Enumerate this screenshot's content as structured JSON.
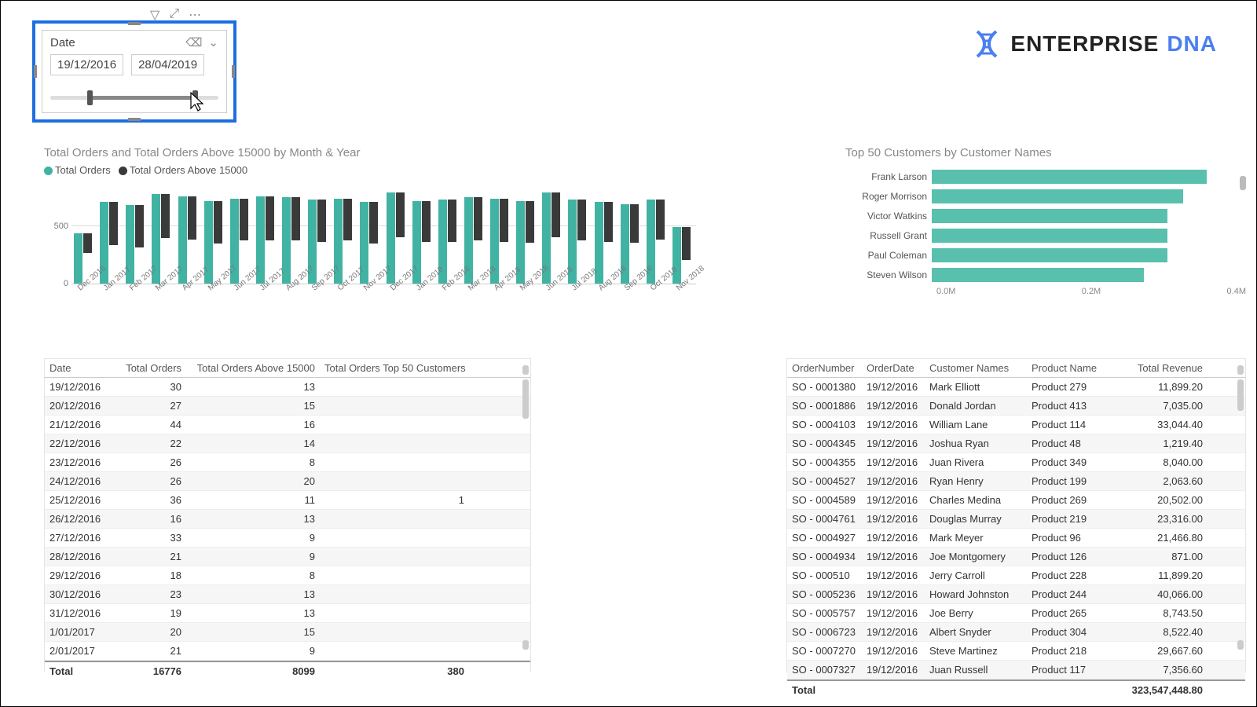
{
  "logo": {
    "text1": "ENTERPRISE",
    "text2": "DNA"
  },
  "slicer": {
    "label": "Date",
    "from": "19/12/2016",
    "to": "28/04/2019"
  },
  "chart_data": [
    {
      "type": "bar",
      "title": "Total Orders and Total Orders Above 15000 by Month & Year",
      "legend": [
        "Total Orders",
        "Total Orders Above 15000"
      ],
      "ylabel": "",
      "ylim": [
        0,
        900
      ],
      "ytick": 500,
      "categories": [
        "Dec 2016",
        "Jan 2017",
        "Feb 2017",
        "Mar 2017",
        "Apr 2017",
        "May 2017",
        "Jun 2017",
        "Jul 2017",
        "Aug 2017",
        "Sep 2017",
        "Oct 2017",
        "Nov 2017",
        "Dec 2017",
        "Jan 2018",
        "Feb 2018",
        "Mar 2018",
        "Apr 2018",
        "May 2018",
        "Jun 2018",
        "Jul 2018",
        "Aug 2018",
        "Sep 2018",
        "Oct 2018",
        "Nov 2018"
      ],
      "series": [
        {
          "name": "Total Orders",
          "color": "#41b3a3",
          "values": [
            440,
            720,
            690,
            790,
            770,
            730,
            750,
            770,
            760,
            740,
            750,
            720,
            800,
            730,
            740,
            760,
            750,
            730,
            800,
            740,
            720,
            700,
            740,
            500
          ]
        },
        {
          "name": "Total Orders Above 15000",
          "color": "#3a3a3a",
          "values": [
            170,
            380,
            370,
            390,
            380,
            380,
            370,
            390,
            380,
            370,
            370,
            370,
            390,
            360,
            370,
            380,
            380,
            370,
            390,
            360,
            350,
            340,
            350,
            290
          ]
        }
      ]
    },
    {
      "type": "bar",
      "orientation": "horizontal",
      "title": "Top 50 Customers by Customer Names",
      "xlabel": "",
      "xlim": [
        0,
        0.4
      ],
      "xticks": [
        "0.0M",
        "0.2M",
        "0.4M"
      ],
      "categories": [
        "Frank Larson",
        "Roger Morrison",
        "Victor Watkins",
        "Russell Grant",
        "Paul Coleman",
        "Steven Wilson"
      ],
      "values": [
        0.35,
        0.32,
        0.3,
        0.3,
        0.3,
        0.27
      ]
    }
  ],
  "table_left": {
    "headers": [
      "Date",
      "Total Orders",
      "Total Orders Above 15000",
      "Total Orders Top 50 Customers"
    ],
    "rows": [
      [
        "19/12/2016",
        "30",
        "13",
        ""
      ],
      [
        "20/12/2016",
        "27",
        "15",
        ""
      ],
      [
        "21/12/2016",
        "44",
        "16",
        ""
      ],
      [
        "22/12/2016",
        "22",
        "14",
        ""
      ],
      [
        "23/12/2016",
        "26",
        "8",
        ""
      ],
      [
        "24/12/2016",
        "26",
        "20",
        ""
      ],
      [
        "25/12/2016",
        "36",
        "11",
        "1"
      ],
      [
        "26/12/2016",
        "16",
        "13",
        ""
      ],
      [
        "27/12/2016",
        "33",
        "9",
        ""
      ],
      [
        "28/12/2016",
        "21",
        "9",
        ""
      ],
      [
        "29/12/2016",
        "18",
        "8",
        ""
      ],
      [
        "30/12/2016",
        "23",
        "13",
        ""
      ],
      [
        "31/12/2016",
        "19",
        "13",
        ""
      ],
      [
        "1/01/2017",
        "20",
        "15",
        ""
      ],
      [
        "2/01/2017",
        "21",
        "9",
        ""
      ]
    ],
    "footer": [
      "Total",
      "16776",
      "8099",
      "380"
    ]
  },
  "table_right": {
    "headers": [
      "OrderNumber",
      "OrderDate",
      "Customer Names",
      "Product Name",
      "Total Revenue"
    ],
    "rows": [
      [
        "SO - 0001380",
        "19/12/2016",
        "Mark Elliott",
        "Product 279",
        "11,899.20"
      ],
      [
        "SO - 0001886",
        "19/12/2016",
        "Donald Jordan",
        "Product 413",
        "7,035.00"
      ],
      [
        "SO - 0004103",
        "19/12/2016",
        "William Lane",
        "Product 114",
        "33,044.40"
      ],
      [
        "SO - 0004345",
        "19/12/2016",
        "Joshua Ryan",
        "Product 48",
        "1,219.40"
      ],
      [
        "SO - 0004355",
        "19/12/2016",
        "Juan Rivera",
        "Product 349",
        "8,040.00"
      ],
      [
        "SO - 0004527",
        "19/12/2016",
        "Ryan Henry",
        "Product 199",
        "2,063.60"
      ],
      [
        "SO - 0004589",
        "19/12/2016",
        "Charles Medina",
        "Product 269",
        "20,502.00"
      ],
      [
        "SO - 0004761",
        "19/12/2016",
        "Douglas Murray",
        "Product 219",
        "23,316.00"
      ],
      [
        "SO - 0004927",
        "19/12/2016",
        "Mark Meyer",
        "Product 96",
        "21,466.80"
      ],
      [
        "SO - 0004934",
        "19/12/2016",
        "Joe Montgomery",
        "Product 126",
        "871.00"
      ],
      [
        "SO - 000510",
        "19/12/2016",
        "Jerry Carroll",
        "Product 228",
        "11,899.20"
      ],
      [
        "SO - 0005236",
        "19/12/2016",
        "Howard Johnston",
        "Product 244",
        "40,066.00"
      ],
      [
        "SO - 0005757",
        "19/12/2016",
        "Joe Berry",
        "Product 265",
        "8,743.50"
      ],
      [
        "SO - 0006723",
        "19/12/2016",
        "Albert Snyder",
        "Product 304",
        "8,522.40"
      ],
      [
        "SO - 0007270",
        "19/12/2016",
        "Steve Martinez",
        "Product 218",
        "29,667.60"
      ],
      [
        "SO - 0007327",
        "19/12/2016",
        "Juan Russell",
        "Product 117",
        "7,356.60"
      ]
    ],
    "footer": [
      "Total",
      "",
      "",
      "",
      "323,547,448.80"
    ]
  }
}
